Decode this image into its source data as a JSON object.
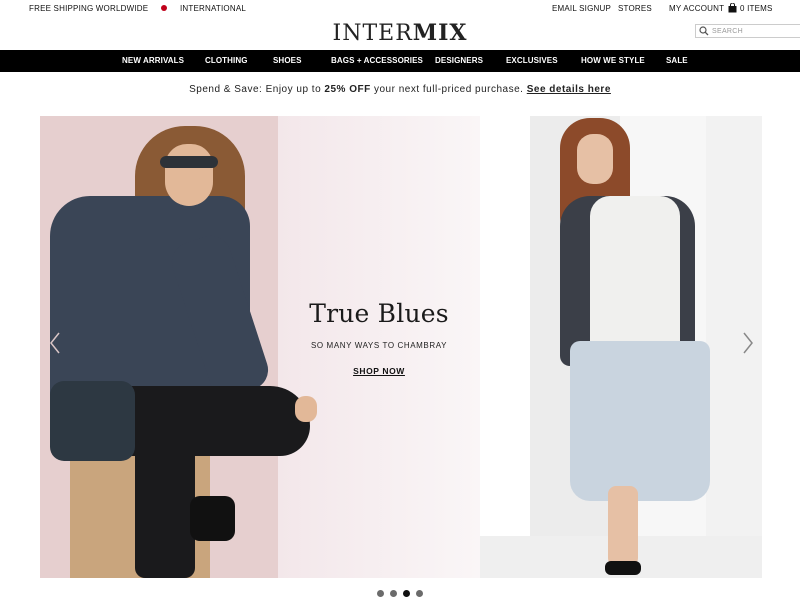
{
  "utility": {
    "shipping": "FREE SHIPPING WORLDWIDE",
    "international": "INTERNATIONAL",
    "email_signup": "EMAIL SIGNUP",
    "stores": "STORES",
    "my_account": "MY ACCOUNT",
    "bag_items": "0 ITEMS"
  },
  "logo": {
    "part1": "INTER",
    "part2": "MIX"
  },
  "search": {
    "placeholder": "SEARCH"
  },
  "nav": {
    "items": [
      {
        "label": "NEW ARRIVALS"
      },
      {
        "label": "CLOTHING"
      },
      {
        "label": "SHOES"
      },
      {
        "label": "BAGS + ACCESSORIES"
      },
      {
        "label": "DESIGNERS"
      },
      {
        "label": "EXCLUSIVES"
      },
      {
        "label": "HOW WE STYLE"
      },
      {
        "label": "SALE"
      }
    ]
  },
  "promo": {
    "prefix": "Spend & Save: Enjoy up to ",
    "highlight": "25% OFF",
    "suffix": " your next full-priced purchase. ",
    "link": "See details here"
  },
  "hero": {
    "title": "True Blues",
    "subtitle": "SO MANY WAYS TO CHAMBRAY",
    "cta": "SHOP NOW"
  },
  "carousel": {
    "slides": 4,
    "active_index": 2
  },
  "colors": {
    "nav_bg": "#000000",
    "intl_dot": "#c0001a",
    "accent_text": "#111111"
  }
}
